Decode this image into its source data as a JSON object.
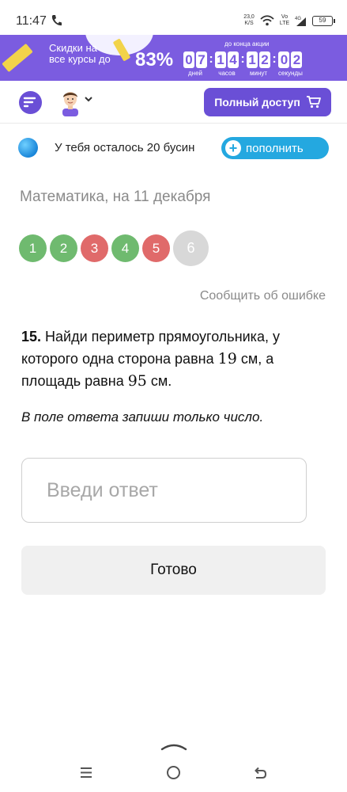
{
  "status_bar": {
    "time": "11:47",
    "speed": "23,0\nK/S",
    "network": "Vo\nLTE",
    "network2": "4G",
    "battery": "59"
  },
  "promo": {
    "text": "Скидки на все курсы до",
    "percent": "83%",
    "until_label": "до конца акции",
    "countdown": [
      {
        "digits": [
          "0",
          "7"
        ],
        "label": "дней"
      },
      {
        "digits": [
          "1",
          "4"
        ],
        "label": "часов"
      },
      {
        "digits": [
          "1",
          "2"
        ],
        "label": "минут"
      },
      {
        "digits": [
          "0",
          "2"
        ],
        "label": "секунды"
      }
    ]
  },
  "header": {
    "full_access_label": "Полный доступ"
  },
  "beads": {
    "text": "У тебя осталось 20 бусин",
    "topup_label": "пополнить"
  },
  "subject": "Математика, на 11 декабря",
  "questions_nav": [
    {
      "label": "1",
      "status": "correct"
    },
    {
      "label": "2",
      "status": "correct"
    },
    {
      "label": "3",
      "status": "wrong"
    },
    {
      "label": "4",
      "status": "correct"
    },
    {
      "label": "5",
      "status": "wrong"
    },
    {
      "label": "6",
      "status": "current"
    }
  ],
  "report_label": "Сообщить об ошибке",
  "question": {
    "number": "15.",
    "text_1": "Найди периметр прямоугольника, у которого одна сторона равна",
    "value_1": "19",
    "text_2": "см, а площадь равна",
    "value_2": "95",
    "text_3": "см.",
    "note": "В поле ответа запиши только число."
  },
  "answer": {
    "placeholder": "Введи ответ",
    "value": ""
  },
  "done_label": "Готово",
  "colors": {
    "brand_purple": "#6a4fd6",
    "promo_purple": "#7b5ce0",
    "topup_blue": "#24a8e0",
    "correct_green": "#6fba6f",
    "wrong_red": "#e06a6a",
    "current_gray": "#d8d8d8"
  }
}
